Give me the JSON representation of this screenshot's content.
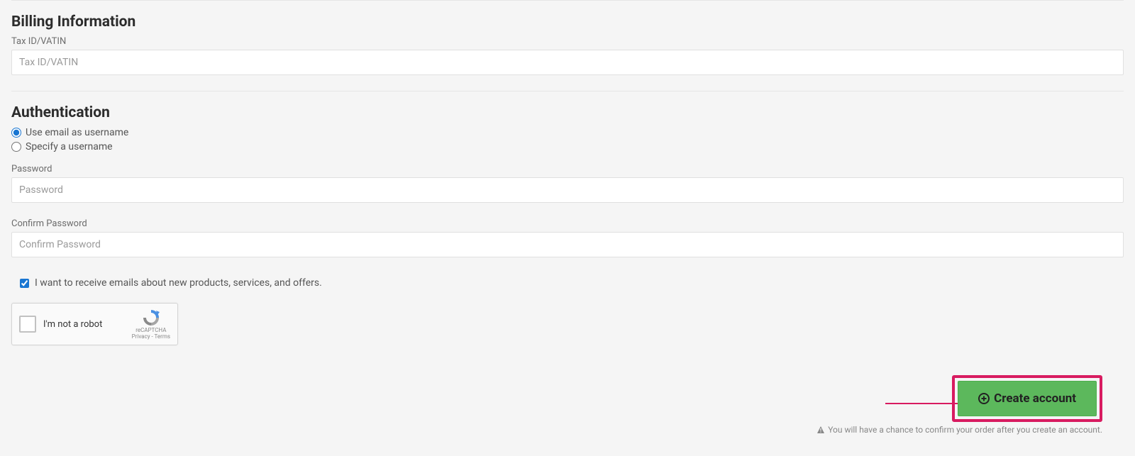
{
  "billing": {
    "heading": "Billing Information",
    "tax_label": "Tax ID/VATIN",
    "tax_placeholder": "Tax ID/VATIN"
  },
  "auth": {
    "heading": "Authentication",
    "option_email": "Use email as username",
    "option_specify": "Specify a username",
    "password_label": "Password",
    "password_placeholder": "Password",
    "confirm_label": "Confirm Password",
    "confirm_placeholder": "Confirm Password"
  },
  "marketing": {
    "checkbox_label": "I want to receive emails about new products, services, and offers."
  },
  "recaptcha": {
    "label": "I'm not a robot",
    "brand": "reCAPTCHA",
    "terms": "Privacy - Terms"
  },
  "action": {
    "create_label": "Create account",
    "hint": "You will have a chance to confirm your order after you create an account."
  }
}
